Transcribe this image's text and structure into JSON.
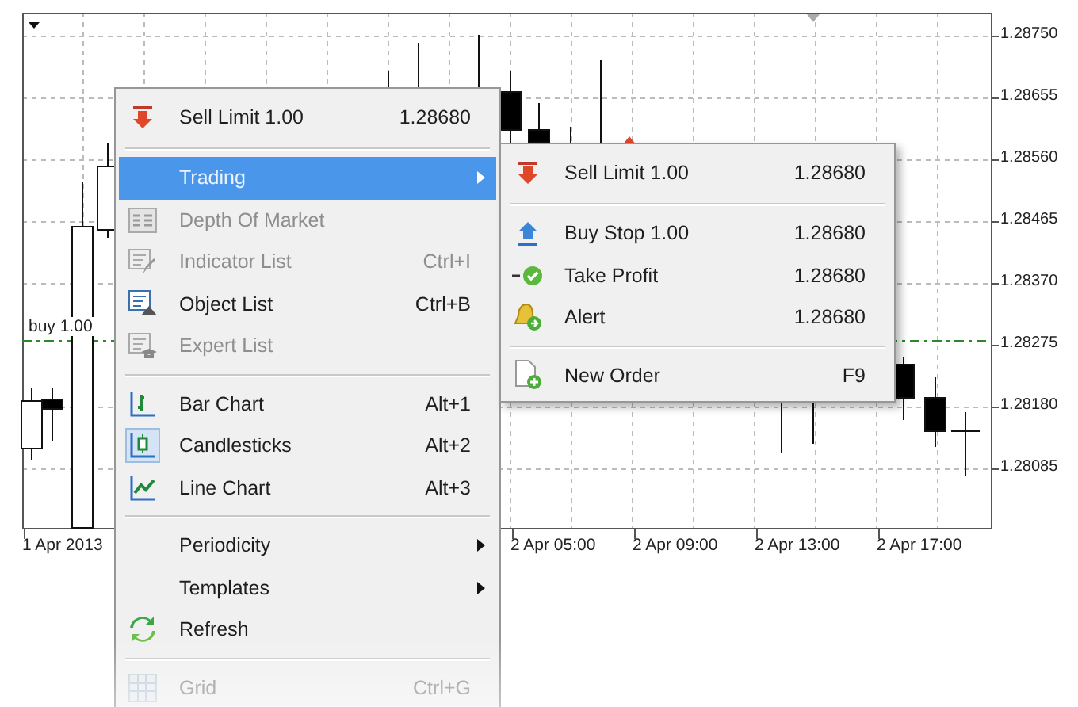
{
  "chart": {
    "price_labels": [
      "1.28750",
      "1.28655",
      "1.28560",
      "1.28465",
      "1.28370",
      "1.28275",
      "1.28180",
      "1.28085"
    ],
    "time_labels": [
      "1 Apr 2013",
      "2 Apr 05:00",
      "2 Apr 09:00",
      "2 Apr 13:00",
      "2 Apr 17:00"
    ],
    "order_line_label": "buy 1.00"
  },
  "context_menu": {
    "items": [
      {
        "kind": "item",
        "label": "Sell Limit 1.00",
        "shortcut": "1.28680",
        "disabled": false,
        "selected": false,
        "checked": false,
        "submenu": false
      },
      {
        "kind": "separator"
      },
      {
        "kind": "item",
        "label": "Trading",
        "disabled": false,
        "selected": true,
        "checked": false,
        "submenu": true
      },
      {
        "kind": "item",
        "label": "Depth Of Market",
        "disabled": true,
        "selected": false,
        "checked": false,
        "submenu": false
      },
      {
        "kind": "item",
        "label": "Indicator List",
        "shortcut": "Ctrl+I",
        "disabled": true,
        "selected": false,
        "checked": false,
        "submenu": false
      },
      {
        "kind": "item",
        "label": "Object List",
        "shortcut": "Ctrl+B",
        "disabled": false,
        "selected": false,
        "checked": false,
        "submenu": false
      },
      {
        "kind": "item",
        "label": "Expert List",
        "disabled": true,
        "selected": false,
        "checked": false,
        "submenu": false
      },
      {
        "kind": "separator"
      },
      {
        "kind": "item",
        "label": "Bar Chart",
        "shortcut": "Alt+1",
        "disabled": false,
        "selected": false,
        "checked": false,
        "submenu": false
      },
      {
        "kind": "item",
        "label": "Candlesticks",
        "shortcut": "Alt+2",
        "disabled": false,
        "selected": false,
        "checked": true,
        "submenu": false
      },
      {
        "kind": "item",
        "label": "Line Chart",
        "shortcut": "Alt+3",
        "disabled": false,
        "selected": false,
        "checked": false,
        "submenu": false
      },
      {
        "kind": "separator"
      },
      {
        "kind": "item",
        "label": "Periodicity",
        "disabled": false,
        "selected": false,
        "checked": false,
        "submenu": true
      },
      {
        "kind": "item",
        "label": "Templates",
        "disabled": false,
        "selected": false,
        "checked": false,
        "submenu": true
      },
      {
        "kind": "item",
        "label": "Refresh",
        "disabled": false,
        "selected": false,
        "checked": false,
        "submenu": false
      },
      {
        "kind": "separator"
      },
      {
        "kind": "item",
        "label": "Grid",
        "shortcut": "Ctrl+G",
        "disabled": true,
        "selected": false,
        "checked": false,
        "submenu": false
      }
    ]
  },
  "trading_submenu": {
    "items": [
      {
        "kind": "item",
        "label": "Sell Limit 1.00",
        "shortcut": "1.28680",
        "disabled": false,
        "selected": false,
        "checked": false,
        "submenu": false
      },
      {
        "kind": "separator"
      },
      {
        "kind": "item",
        "label": "Buy Stop 1.00",
        "shortcut": "1.28680",
        "disabled": false,
        "selected": false,
        "checked": false,
        "submenu": false
      },
      {
        "kind": "item",
        "label": "Take Profit",
        "shortcut": "1.28680",
        "disabled": false,
        "selected": false,
        "checked": false,
        "submenu": false
      },
      {
        "kind": "item",
        "label": "Alert",
        "shortcut": "1.28680",
        "disabled": false,
        "selected": false,
        "checked": false,
        "submenu": false
      },
      {
        "kind": "separator"
      },
      {
        "kind": "item",
        "label": "New Order",
        "shortcut": "F9",
        "disabled": false,
        "selected": false,
        "checked": false,
        "submenu": false
      }
    ]
  }
}
